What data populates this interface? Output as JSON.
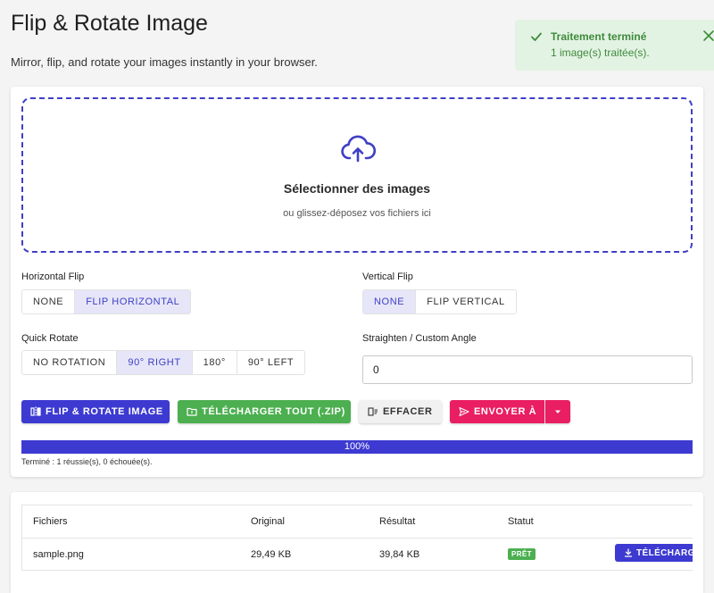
{
  "page": {
    "title": "Flip & Rotate Image",
    "subtitle": "Mirror, flip, and rotate your images instantly in your browser."
  },
  "toast": {
    "title": "Traitement terminé",
    "message": "1 image(s) traitée(s).",
    "color": "#3f8a3c",
    "background": "#e3f3e3"
  },
  "dropzone": {
    "title": "Sélectionner des images",
    "subtitle": "ou glissez-déposez vos fichiers ici",
    "icon": "cloud-upload-icon"
  },
  "horizontal_flip": {
    "label": "Horizontal Flip",
    "options": [
      "NONE",
      "FLIP HORIZONTAL"
    ],
    "selected": "FLIP HORIZONTAL"
  },
  "vertical_flip": {
    "label": "Vertical Flip",
    "options": [
      "NONE",
      "FLIP VERTICAL"
    ],
    "selected": "NONE"
  },
  "quick_rotate": {
    "label": "Quick Rotate",
    "options": [
      "NO ROTATION",
      "90° RIGHT",
      "180°",
      "90° LEFT"
    ],
    "selected": "90° RIGHT"
  },
  "custom_angle": {
    "label": "Straighten / Custom Angle",
    "value": "0"
  },
  "actions": {
    "flip_rotate": "FLIP & ROTATE IMAGE",
    "download_zip": "TÉLÉCHARGER TOUT (.ZIP)",
    "clear": "EFFACER",
    "send_to": "ENVOYER À"
  },
  "progress": {
    "percent": 100,
    "label": "100%",
    "summary": "Terminé : 1 réussie(s), 0 échouée(s)."
  },
  "table": {
    "headers": [
      "Fichiers",
      "Original",
      "Résultat",
      "Statut"
    ],
    "rows": [
      {
        "file": "sample.png",
        "original": "29,49 KB",
        "result": "39,84 KB",
        "status": "PRÊT",
        "action": "TÉLÉCHARGER"
      }
    ]
  },
  "colors": {
    "primary": "#3d3ad1",
    "success": "#4caf50",
    "pink": "#e91e63",
    "active_segment": "#e6e6f8"
  }
}
